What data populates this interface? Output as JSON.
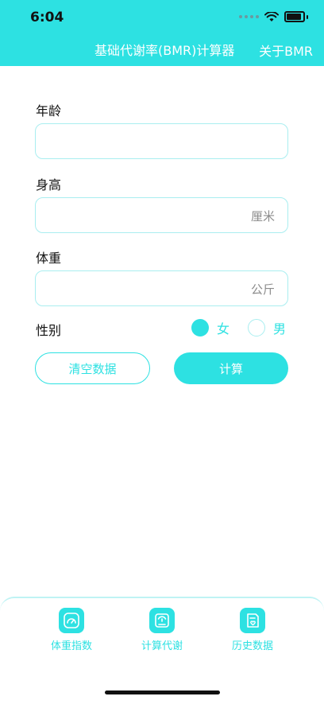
{
  "status_bar": {
    "time": "6:04"
  },
  "nav": {
    "title": "基础代谢率(BMR)计算器",
    "about": "关于BMR"
  },
  "form": {
    "age": {
      "label": "年龄",
      "value": ""
    },
    "height": {
      "label": "身高",
      "value": "",
      "unit": "厘米"
    },
    "weight": {
      "label": "体重",
      "value": "",
      "unit": "公斤"
    },
    "gender": {
      "label": "性别",
      "options": [
        {
          "label": "女",
          "selected": true
        },
        {
          "label": "男",
          "selected": false
        }
      ]
    }
  },
  "buttons": {
    "clear": "清空数据",
    "calculate": "计算"
  },
  "tabbar": {
    "items": [
      {
        "label": "体重指数",
        "icon": "gauge-icon"
      },
      {
        "label": "计算代谢",
        "icon": "scale-icon"
      },
      {
        "label": "历史数据",
        "icon": "history-icon"
      }
    ]
  },
  "colors": {
    "accent": "#2de1e2",
    "field_border": "#a9eef0"
  }
}
